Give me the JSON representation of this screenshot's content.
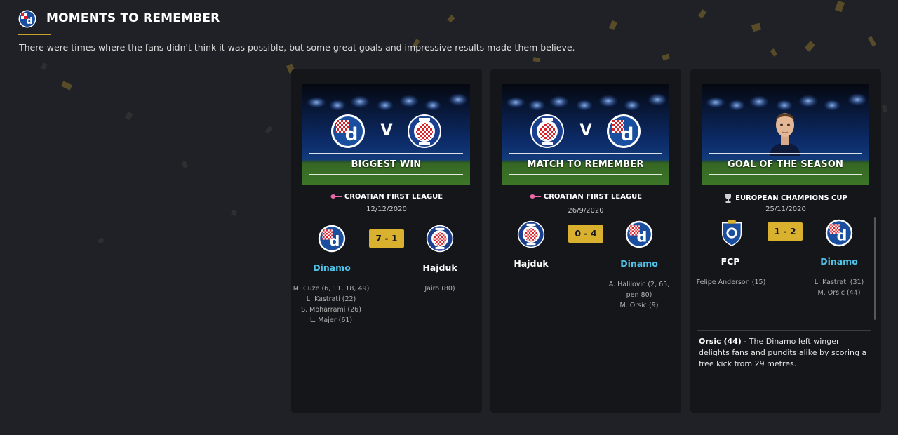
{
  "header": {
    "title": "MOMENTS TO REMEMBER",
    "subtitle": "There were times where the fans didn't think it was possible, but some great goals and impressive results made them believe."
  },
  "colors": {
    "background": "#1f2127",
    "card": "#15161a",
    "accent_gold": "#d9b12f",
    "highlight_team": "#4fc3e8",
    "dinamo_blue": "#1a4fa0",
    "hajduk_red": "#d8232a"
  },
  "cards": [
    {
      "banner_label": "BIGGEST WIN",
      "vs": "V",
      "banner_left_badge": "dinamo-badge",
      "banner_right_badge": "hajduk-badge",
      "competition": "CROATIAN FIRST LEAGUE",
      "competition_icon": "league-trophy-icon",
      "date": "12/12/2020",
      "score": "7 - 1",
      "home_team": "Dinamo",
      "away_team": "Hajduk",
      "home_scorers": [
        "M. Cuze (6, 11, 18, 49)",
        "L. Kastrati (22)",
        "S. Moharrami (26)",
        "L. Majer (61)"
      ],
      "away_scorers": [
        "Jairo (80)"
      ]
    },
    {
      "banner_label": "MATCH TO REMEMBER",
      "vs": "V",
      "banner_left_badge": "hajduk-badge",
      "banner_right_badge": "dinamo-badge",
      "competition": "CROATIAN FIRST LEAGUE",
      "competition_icon": "league-trophy-icon",
      "date": "26/9/2020",
      "score": "0 - 4",
      "home_team": "Hajduk",
      "away_team": "Dinamo",
      "home_scorers": [],
      "away_scorers": [
        "A. Halilovic (2, 65,",
        "pen 80)",
        "M. Orsic (9)"
      ]
    },
    {
      "banner_label": "GOAL OF THE SEASON",
      "competition": "EUROPEAN CHAMPIONS CUP",
      "competition_icon": "champions-cup-icon",
      "date": "25/11/2020",
      "score": "1 - 2",
      "home_team": "FCP",
      "away_team": "Dinamo",
      "home_scorers": [
        "Felipe Anderson (15)"
      ],
      "away_scorers": [
        "L. Kastrati (31)",
        "M. Orsic (44)"
      ],
      "description_bold": "Orsic (44)",
      "description": " - The Dinamo left winger delights fans and pundits alike by scoring a free kick from 29 metres."
    }
  ]
}
